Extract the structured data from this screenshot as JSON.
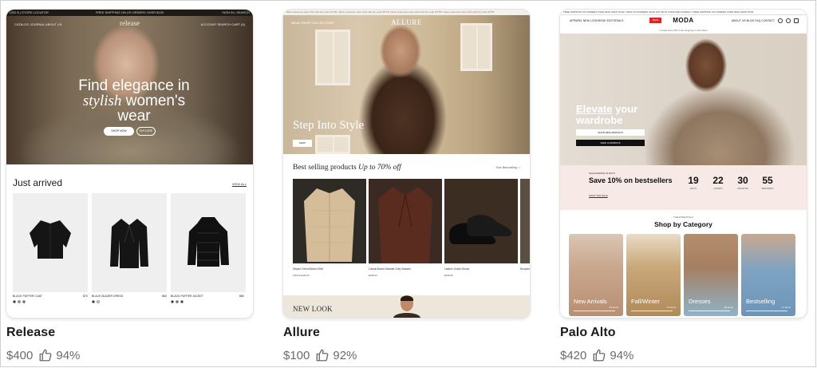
{
  "cards": [
    {
      "title": "Release",
      "price": "$400",
      "rating": "94%",
      "preview": {
        "topbar_left": "USD $ | STORE LOCATOR",
        "topbar_center": "FREE SHIPPING ON US ORDERS OVER $100",
        "topbar_right": "SIGN IN | SEARCH",
        "nav_left": "CATALOG   JOURNAL   ABOUT US",
        "logo": "release",
        "nav_right": "ACCOUNT   SEARCH   CART (0)",
        "headline_1": "Find elegance in",
        "headline_2_italic": "stylish",
        "headline_2_rest": "women's",
        "headline_3": "wear",
        "cta_primary": "SHOP NOW",
        "cta_secondary": "EXPLORE",
        "section_title": "Just arrived",
        "view_all": "VIEW ALL",
        "products": [
          {
            "name": "BLACK PUFFER COAT",
            "price": "$70"
          },
          {
            "name": "BLACK BLAZER DRESS",
            "price": "$60"
          },
          {
            "name": "BLACK PUFFER JACKET",
            "price": "$80"
          }
        ]
      }
    },
    {
      "title": "Allure",
      "price": "$100",
      "rating": "92%",
      "preview": {
        "ticker": "Most customers save 10% with the code WTTB  •  Most customers save 10% with the code WTTB  •  Most customers save 10% with the code WTTB  •  Most customers save 10% with the code WTTB",
        "logo": "ALLURE",
        "nav_left": "MENU   SHOP   COLLECTIONS",
        "hero_title": "Step Into Style",
        "hero_cta": "SHOP",
        "best_prefix": "Best selling products",
        "best_italic": "Up to 70% off",
        "sort_label": "Sort: Best selling  ‹  ›",
        "products": [
          {
            "name": "Striped Oxford Button Shirt",
            "price": "FROM $128.00"
          },
          {
            "name": "Casual Boxed Sweater Grey Sweater",
            "price": "$298.00"
          },
          {
            "name": "Leather Oxford Shoes",
            "price": "$298.00"
          },
          {
            "name": "Neoprene",
            "price": ""
          }
        ],
        "footer_title": "NEW LOOK"
      }
    },
    {
      "title": "Palo Alto",
      "price": "$420",
      "rating": "94%",
      "preview": {
        "ticker": "FREE SHIPPING ON ORDERS OVER $100  SHOP NOW   •   NEW CUSTOMERS SAVE 10% WITH CODE WELCOME10   •   FREE SHIPPING ON ORDERS OVER $100  SHOP NOW",
        "nav_left": "APPAREL   NEW   LOOKBOOK   EDITORIALS",
        "sale_badge": "SALE",
        "logo": "MODA",
        "nav_right": "ABOUT US   BLOG   FAQ   CONTACT",
        "subheader": "Limited time offer! Free shipping on all orders",
        "hero_line_1": "Elevate",
        "hero_line_1_rest": "your",
        "hero_line_2": "wardrobe",
        "cta_new": "SHOP NEW ARRIVALS",
        "cta_lookbook": "VIEW LOOKBOOK",
        "promo_kicker": "SALE ENDING IN DAYS",
        "promo_title": "Save 10% on bestsellers",
        "promo_link": "SHOP THE SALE",
        "countdown": [
          {
            "value": "19",
            "label": "DAYS"
          },
          {
            "value": "22",
            "label": "HOURS"
          },
          {
            "value": "30",
            "label": "MINUTES"
          },
          {
            "value": "55",
            "label": "SECONDS"
          }
        ],
        "essentials": "THE ESSENTIALS",
        "category_heading": "Shop by Category",
        "categories": [
          {
            "label": "New Arrivals",
            "count": "32 items"
          },
          {
            "label": "Fall/Winter",
            "count": "24 items"
          },
          {
            "label": "Dresses",
            "count": "18 items"
          },
          {
            "label": "Bestselling",
            "count": "27 items"
          }
        ]
      }
    }
  ],
  "icons": {
    "rating": "thumbs-up-icon"
  },
  "colors": {
    "sale_red": "#d6282b",
    "promo_pink": "#f6e9e6",
    "meta_gray": "#6b6b6b"
  }
}
